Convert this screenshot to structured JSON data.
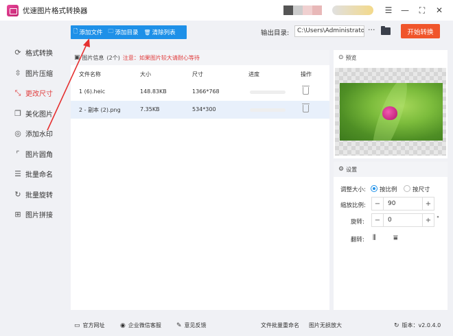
{
  "app": {
    "title": "优速图片格式转换器"
  },
  "window_controls": {
    "menu": "☰",
    "minimize": "—",
    "maximize": "⛶",
    "close": "✕"
  },
  "sidebar": {
    "items": [
      {
        "label": "格式转换",
        "icon": "format-convert-icon",
        "glyph": "⟳",
        "active": false
      },
      {
        "label": "图片压缩",
        "icon": "compress-icon",
        "glyph": "⇳",
        "active": false
      },
      {
        "label": "更改尺寸",
        "icon": "resize-icon",
        "glyph": "⤡",
        "active": true
      },
      {
        "label": "美化图片",
        "icon": "beautify-icon",
        "glyph": "❐",
        "active": false
      },
      {
        "label": "添加水印",
        "icon": "watermark-icon",
        "glyph": "◎",
        "active": false
      },
      {
        "label": "图片圆角",
        "icon": "round-corner-icon",
        "glyph": "⌜",
        "active": false
      },
      {
        "label": "批量命名",
        "icon": "rename-icon",
        "glyph": "☰",
        "active": false
      },
      {
        "label": "批量旋转",
        "icon": "rotate-icon",
        "glyph": "↻",
        "active": false
      },
      {
        "label": "图片拼接",
        "icon": "stitch-icon",
        "glyph": "⊞",
        "active": false
      }
    ]
  },
  "toolbar": {
    "add_file": "添加文件",
    "add_dir": "添加目录",
    "clear_list": "清除列表"
  },
  "output": {
    "label": "输出目录:",
    "path": "C:\\Users\\Administrator\\",
    "more": "···",
    "start": "开始转换"
  },
  "file_panel": {
    "header": "图片信息",
    "count": "(2个)",
    "notice": "注意：如果图片较大请耐心等待",
    "columns": {
      "name": "文件名称",
      "size": "大小",
      "dims": "尺寸",
      "progress": "进度",
      "action": "操作"
    },
    "rows": [
      {
        "name": "1 (6).heic",
        "size": "148.83KB",
        "dims": "1366*768",
        "progress": 0,
        "selected": false
      },
      {
        "name": "2 - 副本 (2).png",
        "size": "7.35KB",
        "dims": "534*300",
        "progress": 0,
        "selected": true
      }
    ]
  },
  "preview": {
    "header": "预览"
  },
  "settings": {
    "header": "设置",
    "resize_label": "调整大小:",
    "opt_ratio": "按比例",
    "opt_size": "按尺寸",
    "scale_label": "缩放比例:",
    "scale_value": "90",
    "rotate_label": "旋转:",
    "rotate_value": "0",
    "degree": "°",
    "flip_label": "翻转:"
  },
  "footer": {
    "website": "官方网址",
    "wechat": "企业微信客服",
    "feedback": "意见反馈",
    "batch_rename": "文件批量重命名",
    "lossless": "图片无损放大",
    "version": "版本：v2.0.4.0"
  }
}
